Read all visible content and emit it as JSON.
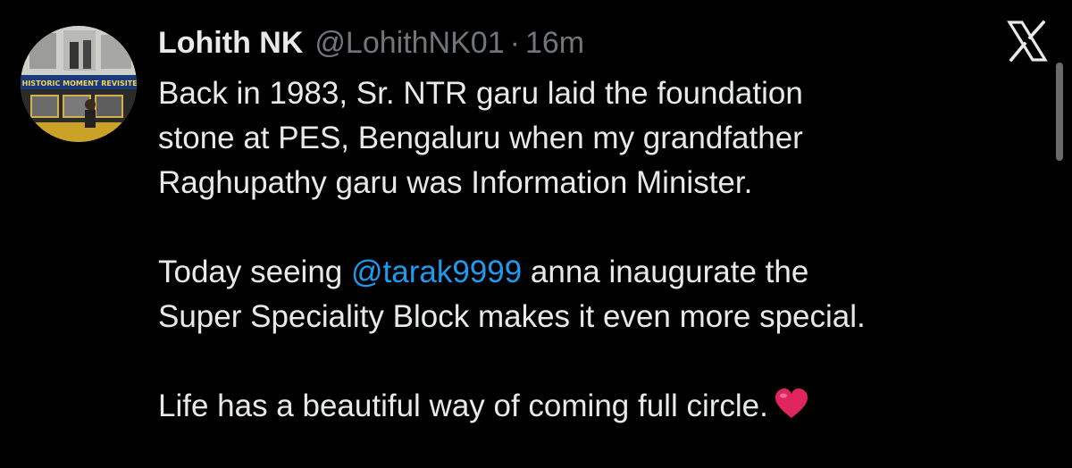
{
  "author": {
    "display_name": "Lohith NK",
    "handle": "@LohithNK01",
    "separator": "·",
    "timestamp": "16m",
    "avatar_banner_text": "A HISTORIC MOMENT REVISITED"
  },
  "platform_icon": "x-logo-icon",
  "tweet": {
    "line1": "Back in 1983, Sr. NTR garu laid the foundation",
    "line2": "stone at PES, Bengaluru when my grandfather",
    "line3": "Raghupathy garu was Information Minister.",
    "line4_before": "Today seeing ",
    "line4_mention": "@tarak9999",
    "line4_after": " anna inaugurate the",
    "line5": "Super Speciality Block makes it even more special.",
    "line6": "Life has a beautiful way of coming full circle.",
    "emoji": "red-heart-icon"
  },
  "colors": {
    "background": "#000000",
    "text": "#e7e9ea",
    "muted": "#71767b",
    "link": "#1d9bf0",
    "heart": "#e0245e"
  }
}
